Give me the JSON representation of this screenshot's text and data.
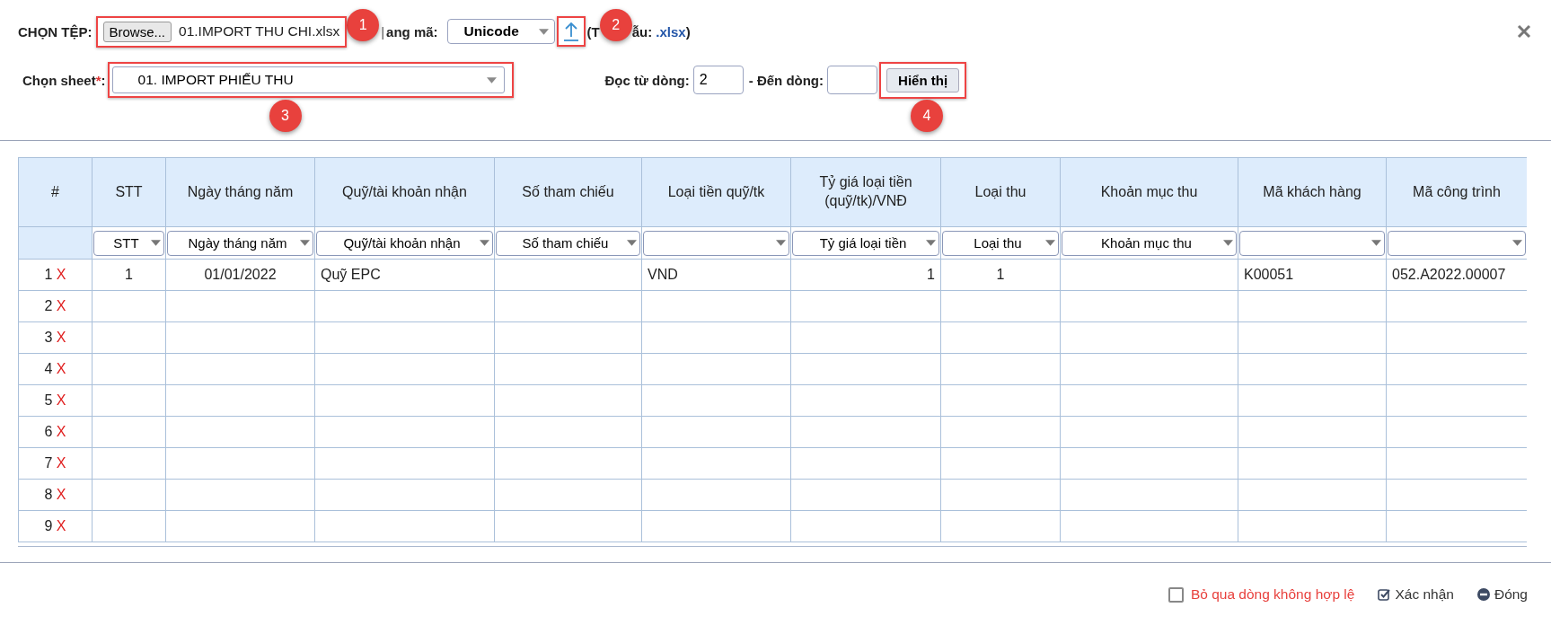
{
  "file_picker": {
    "label": "CHỌN TỆP:",
    "browse_button": "Browse...",
    "file_name": "01.IMPORT THU CHI.xlsx"
  },
  "encoding": {
    "separator": "|",
    "label": "ang mã:",
    "value": "Unicode"
  },
  "template": {
    "prefix": "(T",
    "label": "ẫu:",
    "link": ".xlsx",
    "suffix": ")"
  },
  "badges": [
    "1",
    "2",
    "3",
    "4"
  ],
  "sheet": {
    "label": "Chọn sheet",
    "required_mark": "*",
    "colon": ":",
    "value": "01. IMPORT PHIẾU THU"
  },
  "range": {
    "from_label": "Đọc từ dòng:",
    "from_value": "2",
    "to_label": "- Đến dòng:",
    "show_button": "Hiển thị"
  },
  "table": {
    "columns": [
      {
        "header": "#",
        "has_filter": false
      },
      {
        "header": "STT",
        "has_filter": true,
        "filter_text": "STT"
      },
      {
        "header": "Ngày tháng năm",
        "has_filter": true,
        "filter_text": "Ngày tháng năm"
      },
      {
        "header": "Quỹ/tài khoản nhận",
        "has_filter": true,
        "filter_text": "Quỹ/tài khoản nhận"
      },
      {
        "header": "Số tham chiếu",
        "has_filter": true,
        "filter_text": "Số tham chiếu"
      },
      {
        "header": "Loại tiền quỹ/tk",
        "has_filter": true
      },
      {
        "header": "Tỷ giá loại tiền (quỹ/tk)/VNĐ",
        "has_filter": true,
        "filter_text": "Tỷ giá loại tiền"
      },
      {
        "header": "Loại thu",
        "has_filter": true,
        "filter_text": "Loại thu"
      },
      {
        "header": "Khoản mục thu",
        "has_filter": true,
        "filter_text": "Khoản mục thu"
      },
      {
        "header": "Mã khách hàng",
        "has_filter": true
      },
      {
        "header": "Mã công trình",
        "has_filter": true
      }
    ],
    "rows": [
      {
        "index": "1",
        "delete": "X",
        "cells": [
          "1",
          "01/01/2022",
          "Quỹ EPC",
          null,
          "VND",
          "1",
          "1",
          null,
          "K00051",
          "052.A2022.00007"
        ]
      },
      {
        "index": "2",
        "delete": "X"
      },
      {
        "index": "3",
        "delete": "X"
      },
      {
        "index": "4",
        "delete": "X"
      },
      {
        "index": "5",
        "delete": "X"
      },
      {
        "index": "6",
        "delete": "X"
      },
      {
        "index": "7",
        "delete": "X"
      },
      {
        "index": "8",
        "delete": "X"
      },
      {
        "index": "9",
        "delete": "X"
      }
    ]
  },
  "footer": {
    "skip_invalid": {
      "label": "Bỏ qua dòng không hợp lệ",
      "checked": false
    },
    "confirm": "Xác nhận",
    "close": "Đóng"
  }
}
